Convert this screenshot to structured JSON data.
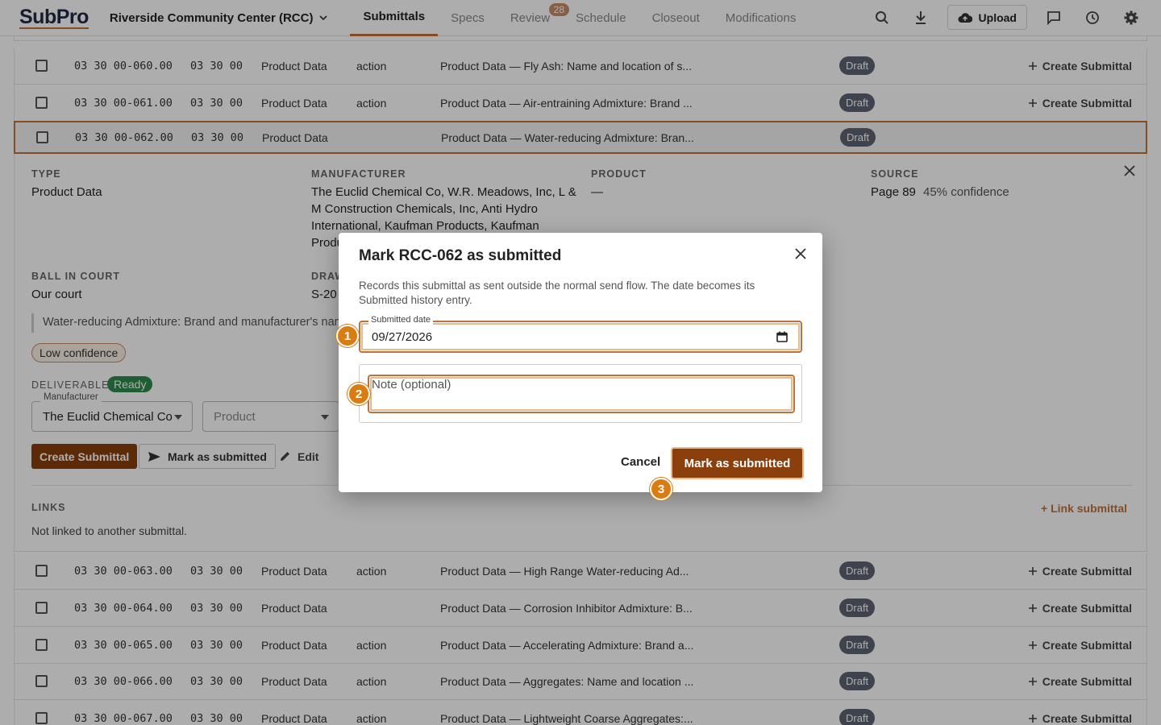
{
  "app": {
    "logo": "SubPro",
    "project": "Riverside Community Center (RCC)"
  },
  "nav": {
    "tabs": [
      {
        "label": "Submittals",
        "active": true
      },
      {
        "label": "Specs"
      },
      {
        "label": "Review",
        "badge": "28"
      },
      {
        "label": "Schedule"
      },
      {
        "label": "Closeout"
      },
      {
        "label": "Modifications"
      }
    ]
  },
  "toolbar": {
    "upload_label": "Upload"
  },
  "rows_top": [
    {
      "num": "03 30 00-060.00",
      "spec": "03 30 00",
      "type": "Product Data",
      "action": "action",
      "title": "Product Data — Fly Ash: Name and location of s...",
      "status": "Draft",
      "create": "Create Submittal"
    },
    {
      "num": "03 30 00-061.00",
      "spec": "03 30 00",
      "type": "Product Data",
      "action": "action",
      "title": "Product Data — Air-entraining Admixture: Brand ...",
      "status": "Draft",
      "create": "Create Submittal"
    },
    {
      "num": "03 30 00-062.00",
      "spec": "03 30 00",
      "type": "Product Data",
      "action": "",
      "title": "Product Data — Water-reducing Admixture: Bran...",
      "status": "Draft",
      "create": ""
    }
  ],
  "detail": {
    "type_label": "TYPE",
    "type_value": "Product Data",
    "manufacturer_label": "MANUFACTURER",
    "manufacturer_line1": "The Euclid Chemical Co, W.R. Meadows, Inc, L &",
    "manufacturer_line2": "M Construction Chemicals, Inc, Anti Hydro",
    "manufacturer_line3": "International, Kaufman Products, Kaufman",
    "manufacturer_line4": "Produ",
    "product_label": "PRODUCT",
    "product_value": "—",
    "source_label": "SOURCE",
    "source_page": "Page 89",
    "source_confidence": "45% confidence",
    "ball_label": "BALL IN COURT",
    "ball_value": "Our court",
    "drawing_label": "DRAW",
    "drawing_value": "S-20",
    "quote": "Water-reducing Admixture: Brand and manufacturer's name",
    "low_confidence": "Low confidence",
    "deliverables_label": "DELIVERABLES",
    "ready": "Ready",
    "manufacturer_select_label": "Manufacturer",
    "manufacturer_select_value": "The Euclid Chemical Co",
    "product_select_placeholder": "Product",
    "create_submittal": "Create Submittal",
    "mark_submitted": "Mark as submitted",
    "edit": "Edit",
    "links_label": "LINKS",
    "links_value": "Not linked to another submittal.",
    "link_submittal": "+ Link submittal"
  },
  "rows_bottom": [
    {
      "num": "03 30 00-063.00",
      "spec": "03 30 00",
      "type": "Product Data",
      "action": "action",
      "title": "Product Data — High Range Water-reducing Ad...",
      "status": "Draft",
      "create": "Create Submittal"
    },
    {
      "num": "03 30 00-064.00",
      "spec": "03 30 00",
      "type": "Product Data",
      "action": "",
      "title": "Product Data — Corrosion Inhibitor Admixture: B...",
      "status": "Draft",
      "create": "Create Submittal"
    },
    {
      "num": "03 30 00-065.00",
      "spec": "03 30 00",
      "type": "Product Data",
      "action": "action",
      "title": "Product Data — Accelerating Admixture: Brand a...",
      "status": "Draft",
      "create": "Create Submittal"
    },
    {
      "num": "03 30 00-066.00",
      "spec": "03 30 00",
      "type": "Product Data",
      "action": "action",
      "title": "Product Data — Aggregates: Name and location ...",
      "status": "Draft",
      "create": "Create Submittal"
    },
    {
      "num": "03 30 00-067.00",
      "spec": "03 30 00",
      "type": "Product Data",
      "action": "action",
      "title": "Product Data — Lightweight Coarse Aggregates:...",
      "status": "Draft",
      "create": "Create Submittal"
    }
  ],
  "modal": {
    "title": "Mark RCC-062 as submitted",
    "description": "Records this submittal as sent outside the normal send flow. The date becomes its Submitted history entry.",
    "date_label": "Submitted date",
    "date_value": "09/27/2026",
    "note_placeholder": "Note (optional)",
    "cancel": "Cancel",
    "submit": "Mark as submitted"
  },
  "markers": [
    "1",
    "2",
    "3"
  ],
  "colors": {
    "accent": "#c0703a",
    "primary_button": "#8a3f0c",
    "marker": "#d97c12",
    "draft_badge": "#5c6472",
    "ready_badge": "#2f8a4b"
  }
}
